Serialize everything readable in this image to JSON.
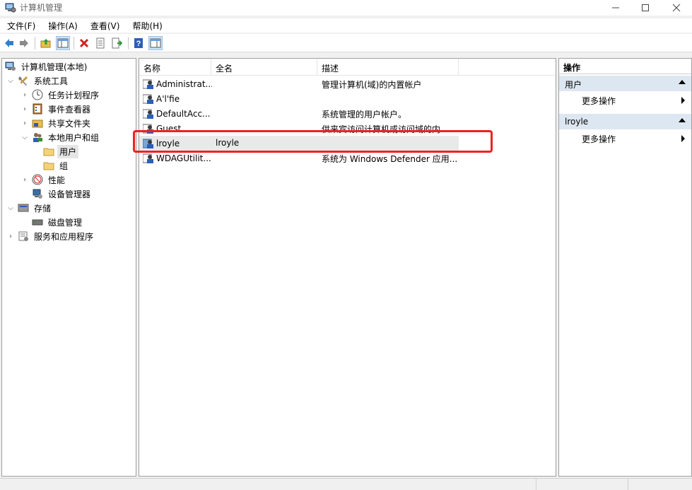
{
  "window": {
    "title": "计算机管理",
    "minimize_label": "—",
    "maximize_label": "☐",
    "close_label": "✕"
  },
  "menu": [
    "文件(F)",
    "操作(A)",
    "查看(V)",
    "帮助(H)"
  ],
  "toolbar": {
    "buttons": [
      "back-icon",
      "forward-icon",
      "up-folder-icon",
      "show-hide-tree-icon",
      "delete-icon",
      "properties-icon",
      "export-list-icon",
      "help-icon",
      "view-pane-icon"
    ]
  },
  "tree": {
    "root": "计算机管理(本地)",
    "system_tools": "系统工具",
    "task_scheduler": "任务计划程序",
    "event_viewer": "事件查看器",
    "shared_folders": "共享文件夹",
    "local_users_groups": "本地用户和组",
    "users": "用户",
    "groups": "组",
    "performance": "性能",
    "device_manager": "设备管理器",
    "storage": "存储",
    "disk_management": "磁盘管理",
    "services_apps": "服务和应用程序"
  },
  "list": {
    "columns": [
      "名称",
      "全名",
      "描述"
    ],
    "rows": [
      {
        "name": "Administrat...",
        "full": "",
        "desc": "管理计算机(域)的内置帐户"
      },
      {
        "name": "A'l'fie",
        "full": "",
        "desc": ""
      },
      {
        "name": "DefaultAcc...",
        "full": "",
        "desc": "系统管理的用户帐户。"
      },
      {
        "name": "Guest",
        "full": "",
        "desc": "供来宾访问计算机或访问域的内..."
      },
      {
        "name": "lroyle",
        "full": "lroyle",
        "desc": ""
      },
      {
        "name": "WDAGUtilit...",
        "full": "",
        "desc": "系统为 Windows Defender 应用..."
      }
    ],
    "selected_index": 4
  },
  "actions": {
    "title": "操作",
    "section1": "用户",
    "section1_more": "更多操作",
    "section2": "lroyle",
    "section2_more": "更多操作"
  },
  "colors": {
    "highlight_box": "#ee2222",
    "section_bg": "#dde7f1"
  }
}
